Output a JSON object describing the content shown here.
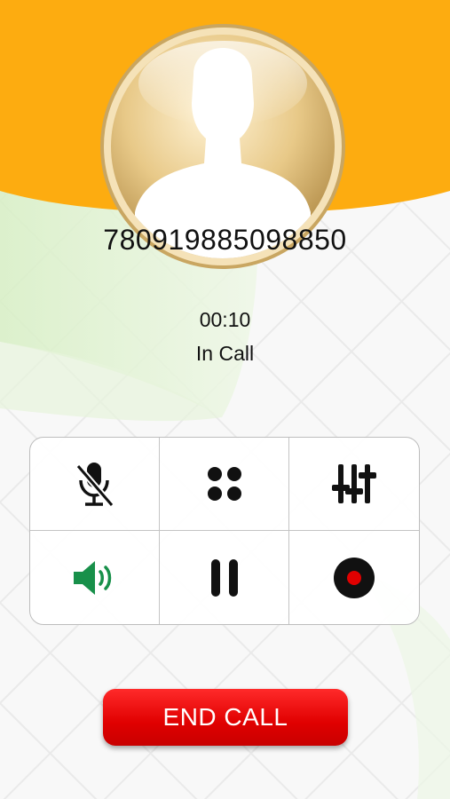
{
  "caller": {
    "number": "780919885098850"
  },
  "call": {
    "duration": "00:10",
    "status": "In Call"
  },
  "controls": [
    {
      "name": "mute",
      "icon": "microphone-muted-icon",
      "active": false
    },
    {
      "name": "keypad",
      "icon": "dialpad-dots-icon",
      "active": false
    },
    {
      "name": "equalizer",
      "icon": "sliders-icon",
      "active": false
    },
    {
      "name": "speaker",
      "icon": "speaker-icon",
      "active": true
    },
    {
      "name": "hold",
      "icon": "pause-icon",
      "active": false
    },
    {
      "name": "record",
      "icon": "record-icon",
      "active": false
    }
  ],
  "end_call": {
    "label": "END CALL"
  },
  "colors": {
    "header": "#fdac10",
    "end_call": "#e60000",
    "speaker_active": "#18904a",
    "record_dot": "#e00000"
  }
}
